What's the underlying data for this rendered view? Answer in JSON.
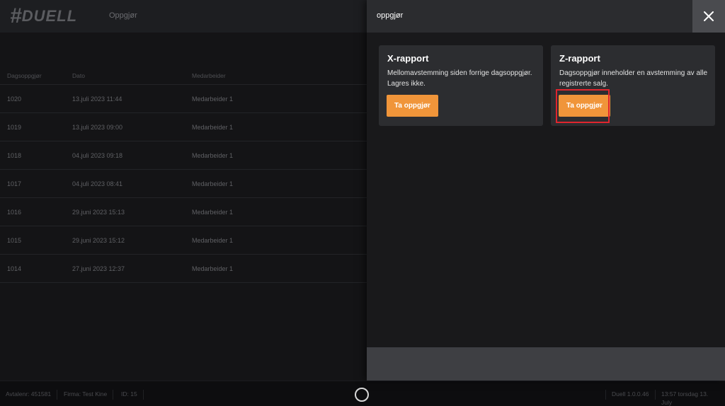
{
  "app": {
    "logo_symbol": "#",
    "logo_text": "DUELL",
    "page_title": "Oppgjør"
  },
  "table": {
    "columns": [
      "Dagsoppgjør",
      "Dato",
      "Medarbeider"
    ],
    "rows": [
      [
        "1020",
        "13.juli 2023 11:44",
        "Medarbeider 1"
      ],
      [
        "1019",
        "13.juli 2023 09:00",
        "Medarbeider 1"
      ],
      [
        "1018",
        "04.juli 2023 09:18",
        "Medarbeider 1"
      ],
      [
        "1017",
        "04.juli 2023 08:41",
        "Medarbeider 1"
      ],
      [
        "1016",
        "29.juni 2023 15:13",
        "Medarbeider 1"
      ],
      [
        "1015",
        "29.juni 2023 15:12",
        "Medarbeider 1"
      ],
      [
        "1014",
        "27.juni 2023 12:37",
        "Medarbeider 1"
      ]
    ]
  },
  "drawer": {
    "title": "oppgjør",
    "close_icon": "close-icon",
    "cards": [
      {
        "title": "X-rapport",
        "description": "Mellomavstemming siden forrige dagsoppgjør. Lagres ikke.",
        "button": "Ta oppgjør"
      },
      {
        "title": "Z-rapport",
        "description": "Dagsoppgjør inneholder en avstemming av alle registrerte salg.",
        "button": "Ta oppgjør"
      }
    ]
  },
  "footer": {
    "avtalenr": "Avtalenr: 451581",
    "firma": "Firma: Test Kine",
    "id": "ID: 15",
    "version": "Duell 1.0.0.46",
    "datetime": "13:57 torsdag 13. July"
  },
  "colors": {
    "accent": "#f0953a",
    "highlight": "#e0252e",
    "background": "#141416"
  }
}
